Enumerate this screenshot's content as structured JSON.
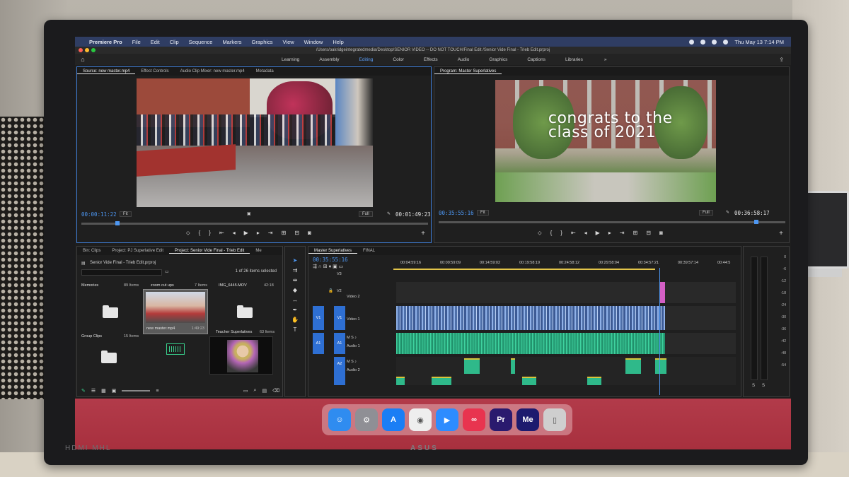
{
  "menubar": {
    "items": [
      "Premiere Pro",
      "File",
      "Edit",
      "Clip",
      "Sequence",
      "Markers",
      "Graphics",
      "View",
      "Window",
      "Help"
    ],
    "datetime": "Thu May 13  7:14 PM"
  },
  "titlebar": {
    "path": "/Users/oakridgeintegratedmedia/Desktop/SENIOR VIDEO -- DO NOT TOUCH/Final Edit /Senior Vide Final - Trieb Edit.prproj"
  },
  "workspaces": {
    "items": [
      "Learning",
      "Assembly",
      "Editing",
      "Color",
      "Effects",
      "Audio",
      "Graphics",
      "Captions",
      "Libraries"
    ],
    "active": "Editing",
    "more": "»"
  },
  "source": {
    "tabs": [
      "Source: new master.mp4",
      "Effect Controls",
      "Audio Clip Mixer: new master.mp4",
      "Metadata"
    ],
    "timecode_current": "00:00:11:22",
    "timecode_duration": "00:01:49:23",
    "zoom": "Fit",
    "resolution": "Full"
  },
  "program": {
    "tab": "Program: Master Superlatives",
    "overlay_text": "congrats to the class of 2021",
    "timecode_current": "00:35:55:16",
    "timecode_duration": "00:36:58:17",
    "zoom": "Fit",
    "resolution": "Full"
  },
  "project": {
    "tabs": [
      "Bin: Clips",
      "Project: PJ Superlative Edit",
      "Project: Senior Vide Final - Trieb Edit",
      "Me"
    ],
    "path": "Senior Vide Final - Trieb Edit.prproj",
    "selection": "1 of 26 items selected",
    "items": [
      {
        "label": "Memories",
        "count": "89 Items"
      },
      {
        "label": "zoom cut ups",
        "count": "7 Items"
      },
      {
        "label": "IMG_6445.MOV",
        "count": "42:18"
      },
      {
        "label": "new master.mp4",
        "count": "1:49:23"
      },
      {
        "label": "Group Clips",
        "count": "15 Items"
      },
      {
        "label": "Teacher Superlatives",
        "count": "63 Items"
      }
    ]
  },
  "timeline": {
    "tabs": [
      "Master Superlatives",
      "FINAL"
    ],
    "timecode": "00:35:55:16",
    "ruler": [
      "00:04:59:16",
      "00:09:59:09",
      "00:14:59:02",
      "00:19:58:19",
      "00:24:58:12",
      "00:29:58:04",
      "00:34:57:21",
      "00:39:57:14",
      "00:44:5"
    ],
    "tracks": {
      "v3": "V3",
      "v2": "V2",
      "v2_name": "Video 2",
      "v1": "V1",
      "v1_name": "Video 1",
      "a1": "A1",
      "a1_name": "Audio 1",
      "a2": "A2",
      "a2_name": "Audio 2"
    }
  },
  "meters": {
    "db": [
      "0",
      "-6",
      "-12",
      "-18",
      "-24",
      "-30",
      "-36",
      "-42",
      "-48",
      "-54"
    ],
    "solo": "S"
  },
  "monitor": {
    "ports": "HDMI  MHL",
    "brand": "ASUS"
  },
  "dock": {
    "apps": [
      {
        "name": "finder-icon",
        "glyph": "☺",
        "color": "#2f8cf0"
      },
      {
        "name": "system-preferences-icon",
        "glyph": "⚙",
        "color": "#8f8f95"
      },
      {
        "name": "app-store-icon",
        "glyph": "A",
        "color": "#1a7ef5"
      },
      {
        "name": "chrome-icon",
        "glyph": "◉",
        "color": "#eeeeee"
      },
      {
        "name": "zoom-icon",
        "glyph": "▶",
        "color": "#2d8cff"
      },
      {
        "name": "creative-cloud-icon",
        "glyph": "∞",
        "color": "#e8344f"
      },
      {
        "name": "premiere-pro-icon",
        "glyph": "Pr",
        "color": "#2a1a6e"
      },
      {
        "name": "media-encoder-icon",
        "glyph": "Me",
        "color": "#1d1a6e"
      },
      {
        "name": "trash-icon",
        "glyph": "▯",
        "color": "#cfcfcf"
      }
    ]
  }
}
